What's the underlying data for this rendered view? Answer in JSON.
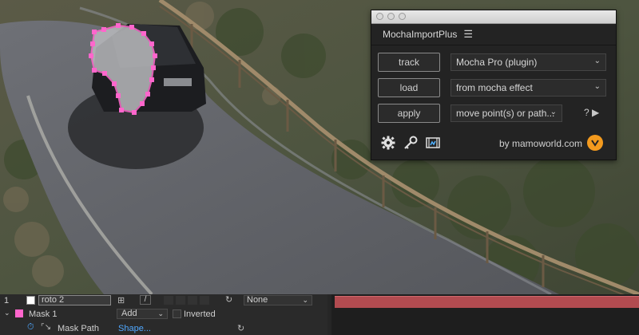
{
  "panel": {
    "title": "MochaImportPlus",
    "menu_icon": "hamburger-icon",
    "rows": [
      {
        "button": "track",
        "select": "Mocha Pro (plugin)"
      },
      {
        "button": "load",
        "select": "from mocha effect"
      },
      {
        "button": "apply",
        "select": "move point(s) or path..."
      }
    ],
    "help": "? ▶",
    "credit": "by mamoworld.com",
    "accent": "#f39a1e"
  },
  "timeline": {
    "layer_number": "1",
    "layer_name": "roto 2",
    "parent_value": "None",
    "mask_name": "Mask 1",
    "mask_mode": "Add",
    "inverted_label": "Inverted",
    "mask_path_label": "Mask Path",
    "mask_path_value": "Shape...",
    "layer_bar_color": "#b24b50",
    "mask_color": "#ff66cc"
  }
}
